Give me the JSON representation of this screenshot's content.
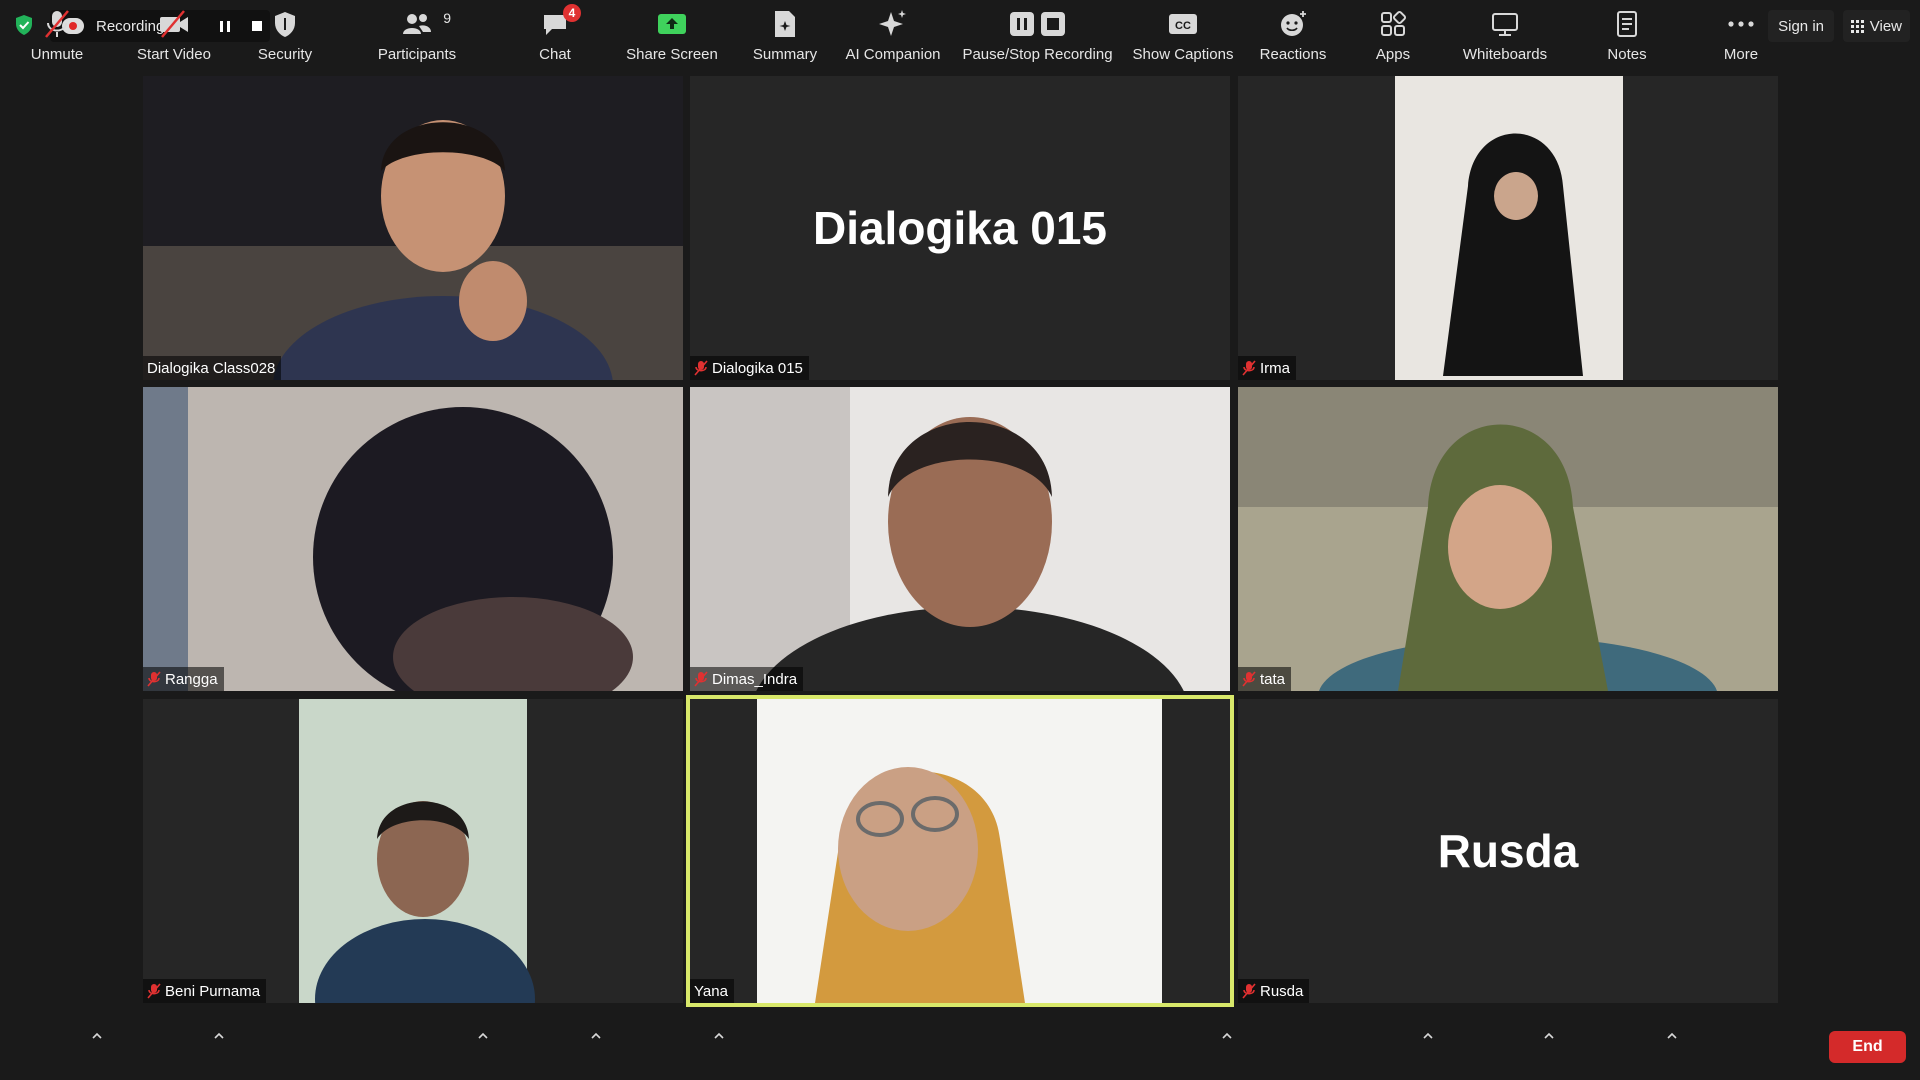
{
  "top": {
    "recording_label": "Recording...",
    "sign_in": "Sign in",
    "view": "View"
  },
  "tiles": [
    {
      "name": "Dialogika Class028",
      "muted": false,
      "video": true
    },
    {
      "name": "Dialogika 015",
      "big_name": "Dialogika 015",
      "muted": true,
      "video": false
    },
    {
      "name": "Irma",
      "muted": true,
      "video": true
    },
    {
      "name": "Rangga",
      "muted": true,
      "video": true
    },
    {
      "name": "Dimas_Indra",
      "muted": true,
      "video": true
    },
    {
      "name": "tata",
      "muted": true,
      "video": true
    },
    {
      "name": "Beni Purnama",
      "muted": true,
      "video": true
    },
    {
      "name": "Yana",
      "muted": false,
      "video": true,
      "active_speaker": true
    },
    {
      "name": "Rusda",
      "big_name": "Rusda",
      "muted": true,
      "video": false
    }
  ],
  "toolbar": {
    "unmute": "Unmute",
    "start_video": "Start Video",
    "security": "Security",
    "participants": "Participants",
    "participants_count": "9",
    "chat": "Chat",
    "chat_badge": "4",
    "share_screen": "Share Screen",
    "summary": "Summary",
    "ai_companion": "AI Companion",
    "pause_stop_recording": "Pause/Stop Recording",
    "show_captions": "Show Captions",
    "reactions": "Reactions",
    "apps": "Apps",
    "whiteboards": "Whiteboards",
    "notes": "Notes",
    "more": "More",
    "end": "End"
  },
  "colors": {
    "active_speaker_border": "#d8e86a",
    "share_screen_green": "#3fd25c",
    "end_red": "#d42a2a",
    "badge_red": "#e03131"
  }
}
